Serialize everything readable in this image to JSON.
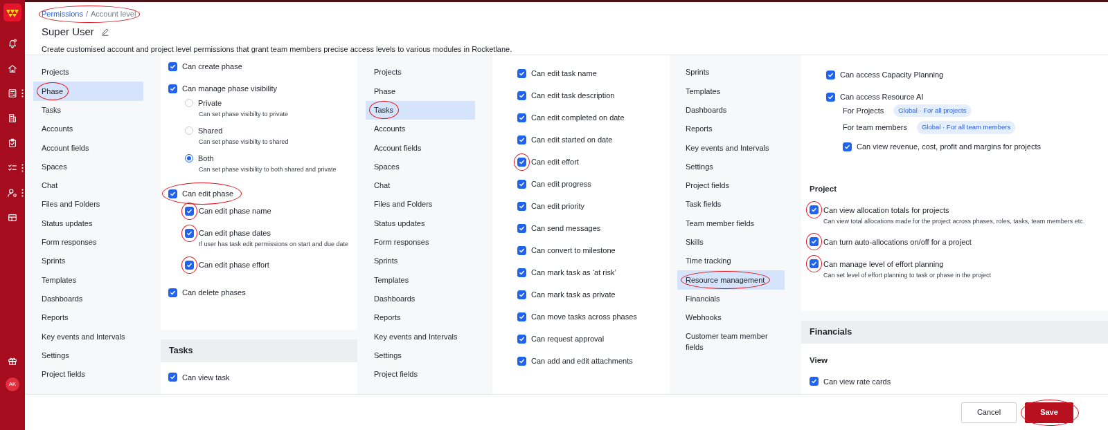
{
  "rail": {
    "avatar": "AK"
  },
  "breadcrumb": {
    "circled": true,
    "separator": "/",
    "items": [
      {
        "label": "Permissions",
        "kind": "link"
      },
      {
        "label": "Account level",
        "kind": "current"
      }
    ]
  },
  "title": "Super User",
  "description": "Create customised account and project level permissions that grant team members precise access levels to various modules in Rocketlane.",
  "panels": [
    {
      "sidebar": [
        {
          "label": "Projects",
          "selected": false,
          "circled": false
        },
        {
          "label": "Phase",
          "selected": true,
          "circled": true
        },
        {
          "label": "Tasks",
          "selected": false,
          "circled": false
        },
        {
          "label": "Accounts",
          "selected": false,
          "circled": false
        },
        {
          "label": "Account fields",
          "selected": false,
          "circled": false
        },
        {
          "label": "Spaces",
          "selected": false,
          "circled": false
        },
        {
          "label": "Chat",
          "selected": false,
          "circled": false
        },
        {
          "label": "Files and Folders",
          "selected": false,
          "circled": false
        },
        {
          "label": "Status updates",
          "selected": false,
          "circled": false
        },
        {
          "label": "Form responses",
          "selected": false,
          "circled": false
        },
        {
          "label": "Sprints",
          "selected": false,
          "circled": false
        },
        {
          "label": "Templates",
          "selected": false,
          "circled": false
        },
        {
          "label": "Dashboards",
          "selected": false,
          "circled": false
        },
        {
          "label": "Reports",
          "selected": false,
          "circled": false
        },
        {
          "label": "Key events and Intervals",
          "selected": false,
          "circled": false
        },
        {
          "label": "Settings",
          "selected": false,
          "circled": false
        },
        {
          "label": "Project fields",
          "selected": false,
          "circled": false
        }
      ],
      "sections": [
        {
          "items": [
            {
              "kind": "checkbox",
              "label": "Can create phase",
              "checked": true,
              "circled": false
            },
            {
              "kind": "checkbox",
              "label": "Can manage phase visibility",
              "checked": true,
              "circled": false,
              "children": [
                {
                  "kind": "radio",
                  "label": "Private",
                  "description": "Can set phase visibilty to private",
                  "selected": false
                },
                {
                  "kind": "radio",
                  "label": "Shared",
                  "description": "Can set phase visibilty to shared",
                  "selected": false
                },
                {
                  "kind": "radio",
                  "label": "Both",
                  "description": "Can set phase visibility to both shared and private",
                  "selected": true
                }
              ]
            },
            {
              "kind": "checkbox",
              "label": "Can edit phase",
              "checked": true,
              "circled": true,
              "circle_wide": true,
              "children": [
                {
                  "kind": "checkbox",
                  "label": "Can edit phase name",
                  "checked": true,
                  "circled": true,
                  "circle_wide": false
                },
                {
                  "kind": "checkbox",
                  "label": "Can edit phase dates",
                  "description": "If user has task edit permissions on start and due date",
                  "checked": true,
                  "circled": true,
                  "circle_wide": false
                },
                {
                  "kind": "checkbox",
                  "label": "Can edit phase effort",
                  "checked": true,
                  "circled": true,
                  "circle_wide": false
                }
              ]
            },
            {
              "kind": "checkbox",
              "label": "Can delete phases",
              "checked": true,
              "circled": false
            }
          ]
        },
        {
          "title": "Tasks",
          "items": [
            {
              "kind": "checkbox",
              "label": "Can view task",
              "checked": true,
              "circled": false
            }
          ]
        }
      ]
    },
    {
      "sidebar": [
        {
          "label": "Projects",
          "selected": false,
          "circled": false
        },
        {
          "label": "Phase",
          "selected": false,
          "circled": false
        },
        {
          "label": "Tasks",
          "selected": true,
          "circled": true
        },
        {
          "label": "Accounts",
          "selected": false,
          "circled": false
        },
        {
          "label": "Account fields",
          "selected": false,
          "circled": false
        },
        {
          "label": "Spaces",
          "selected": false,
          "circled": false
        },
        {
          "label": "Chat",
          "selected": false,
          "circled": false
        },
        {
          "label": "Files and Folders",
          "selected": false,
          "circled": false
        },
        {
          "label": "Status updates",
          "selected": false,
          "circled": false
        },
        {
          "label": "Form responses",
          "selected": false,
          "circled": false
        },
        {
          "label": "Sprints",
          "selected": false,
          "circled": false
        },
        {
          "label": "Templates",
          "selected": false,
          "circled": false
        },
        {
          "label": "Dashboards",
          "selected": false,
          "circled": false
        },
        {
          "label": "Reports",
          "selected": false,
          "circled": false
        },
        {
          "label": "Key events and Intervals",
          "selected": false,
          "circled": false
        },
        {
          "label": "Settings",
          "selected": false,
          "circled": false
        },
        {
          "label": "Project fields",
          "selected": false,
          "circled": false
        }
      ],
      "sections": [
        {
          "items": [
            {
              "kind": "checkbox",
              "label": "Can edit task name",
              "checked": true,
              "circled": false
            },
            {
              "kind": "checkbox",
              "label": "Can edit task description",
              "checked": true,
              "circled": false
            },
            {
              "kind": "checkbox",
              "label": "Can edit completed on date",
              "checked": true,
              "circled": false
            },
            {
              "kind": "checkbox",
              "label": "Can edit started on date",
              "checked": true,
              "circled": false
            },
            {
              "kind": "checkbox",
              "label": "Can edit effort",
              "checked": true,
              "circled": true,
              "circle_wide": false
            },
            {
              "kind": "checkbox",
              "label": "Can edit progress",
              "checked": true,
              "circled": false
            },
            {
              "kind": "checkbox",
              "label": "Can edit priority",
              "checked": true,
              "circled": false
            },
            {
              "kind": "checkbox",
              "label": "Can send messages",
              "checked": true,
              "circled": false
            },
            {
              "kind": "checkbox",
              "label": "Can convert to milestone",
              "checked": true,
              "circled": false
            },
            {
              "kind": "checkbox",
              "label": "Can mark task as ‘at risk’",
              "checked": true,
              "circled": false
            },
            {
              "kind": "checkbox",
              "label": "Can mark task as private",
              "checked": true,
              "circled": false
            },
            {
              "kind": "checkbox",
              "label": "Can move tasks across phases",
              "checked": true,
              "circled": false
            },
            {
              "kind": "checkbox",
              "label": "Can request approval",
              "checked": true,
              "circled": false
            },
            {
              "kind": "checkbox",
              "label": "Can add and edit attachments",
              "checked": true,
              "circled": false
            }
          ]
        }
      ]
    },
    {
      "sidebar": [
        {
          "label": "Sprints",
          "selected": false,
          "circled": false
        },
        {
          "label": "Templates",
          "selected": false,
          "circled": false
        },
        {
          "label": "Dashboards",
          "selected": false,
          "circled": false
        },
        {
          "label": "Reports",
          "selected": false,
          "circled": false
        },
        {
          "label": "Key events and Intervals",
          "selected": false,
          "circled": false
        },
        {
          "label": "Settings",
          "selected": false,
          "circled": false
        },
        {
          "label": "Project fields",
          "selected": false,
          "circled": false
        },
        {
          "label": "Task fields",
          "selected": false,
          "circled": false
        },
        {
          "label": "Team member fields",
          "selected": false,
          "circled": false
        },
        {
          "label": "Skills",
          "selected": false,
          "circled": false
        },
        {
          "label": "Time tracking",
          "selected": false,
          "circled": false
        },
        {
          "label": "Resource management",
          "selected": true,
          "circled": true
        },
        {
          "label": "Financials",
          "selected": false,
          "circled": false
        },
        {
          "label": "Webhooks",
          "selected": false,
          "circled": false
        },
        {
          "label": "Customer team member fields",
          "selected": false,
          "circled": false
        }
      ],
      "sections": [
        {
          "items": [
            {
              "kind": "group",
              "children": [
                {
                  "kind": "checkbox",
                  "label": "Can access Capacity Planning",
                  "checked": true,
                  "circled": false
                },
                {
                  "kind": "checkbox",
                  "label": "Can access Resource AI",
                  "checked": true,
                  "circled": false,
                  "children": [
                    {
                      "kind": "scope",
                      "label": "For Projects",
                      "value": "Global · For all projects"
                    },
                    {
                      "kind": "scope",
                      "label": "For team members",
                      "value": "Global · For all team members"
                    },
                    {
                      "kind": "checkbox",
                      "label": "Can view revenue, cost, profit and margins for projects",
                      "checked": true,
                      "circled": false
                    }
                  ]
                }
              ]
            },
            {
              "kind": "heading",
              "label": "Project"
            },
            {
              "kind": "checkbox",
              "label": "Can view allocation totals for projects",
              "description": "Can view total allocations made for the project across phases, roles, tasks, team members etc.",
              "checked": true,
              "circled": true,
              "circle_wide": false
            },
            {
              "kind": "checkbox",
              "label": "Can turn auto-allocations on/off for a project",
              "checked": true,
              "circled": true,
              "circle_wide": false
            },
            {
              "kind": "checkbox",
              "label": "Can manage level of effort planning",
              "description": "Can set level of effort planning to task or phase in the project",
              "checked": true,
              "circled": true,
              "circle_wide": false
            }
          ]
        },
        {
          "title": "Financials",
          "items": [
            {
              "kind": "heading",
              "label": "View"
            },
            {
              "kind": "checkbox",
              "label": "Can view rate cards",
              "checked": true,
              "circled": false
            }
          ]
        }
      ]
    }
  ],
  "footer": {
    "buttons": [
      {
        "label": "Cancel",
        "kind": "secondary",
        "circled": false
      },
      {
        "label": "Save",
        "kind": "primary",
        "circled": true
      }
    ]
  }
}
